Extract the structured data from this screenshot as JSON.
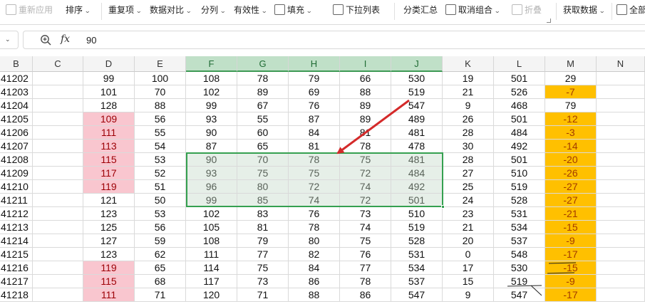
{
  "ribbon": {
    "reapply": "重新应用",
    "sort": "排序",
    "duplicates": "重复项",
    "compare": "数据对比",
    "split": "分列",
    "validity": "有效性",
    "fill": "填充",
    "dropdown": "下拉列表",
    "subtotal": "分类汇总",
    "ungroup": "取消组合",
    "collapse": "折叠",
    "get_data": "获取数据",
    "all": "全部"
  },
  "formula_bar": {
    "fx": "fx",
    "value": "90"
  },
  "columns": [
    "B",
    "C",
    "D",
    "E",
    "F",
    "G",
    "H",
    "I",
    "J",
    "K",
    "L",
    "M",
    "N"
  ],
  "selected_columns": [
    "F",
    "G",
    "H",
    "I",
    "J"
  ],
  "rows": [
    {
      "a": "41202",
      "d": "99",
      "e": "100",
      "f": "108",
      "g": "78",
      "h": "79",
      "i": "66",
      "j": "530",
      "k": "19",
      "l": "501",
      "m": "29"
    },
    {
      "a": "41203",
      "d": "101",
      "e": "70",
      "f": "102",
      "g": "89",
      "h": "69",
      "i": "88",
      "j": "519",
      "k": "21",
      "l": "526",
      "m": "-7"
    },
    {
      "a": "41204",
      "d": "128",
      "e": "88",
      "f": "99",
      "g": "67",
      "h": "76",
      "i": "89",
      "j": "547",
      "k": "9",
      "l": "468",
      "m": "79"
    },
    {
      "a": "41205",
      "d": "109",
      "e": "56",
      "f": "93",
      "g": "55",
      "h": "87",
      "i": "89",
      "j": "489",
      "k": "26",
      "l": "501",
      "m": "-12"
    },
    {
      "a": "41206",
      "d": "111",
      "e": "55",
      "f": "90",
      "g": "60",
      "h": "84",
      "i": "81",
      "j": "481",
      "k": "28",
      "l": "484",
      "m": "-3"
    },
    {
      "a": "41207",
      "d": "113",
      "e": "54",
      "f": "87",
      "g": "65",
      "h": "81",
      "i": "78",
      "j": "478",
      "k": "30",
      "l": "492",
      "m": "-14"
    },
    {
      "a": "41208",
      "d": "115",
      "e": "53",
      "f": "90",
      "g": "70",
      "h": "78",
      "i": "75",
      "j": "481",
      "k": "28",
      "l": "501",
      "m": "-20"
    },
    {
      "a": "41209",
      "d": "117",
      "e": "52",
      "f": "93",
      "g": "75",
      "h": "75",
      "i": "72",
      "j": "484",
      "k": "27",
      "l": "510",
      "m": "-26"
    },
    {
      "a": "41210",
      "d": "119",
      "e": "51",
      "f": "96",
      "g": "80",
      "h": "72",
      "i": "74",
      "j": "492",
      "k": "25",
      "l": "519",
      "m": "-27"
    },
    {
      "a": "41211",
      "d": "121",
      "e": "50",
      "f": "99",
      "g": "85",
      "h": "74",
      "i": "72",
      "j": "501",
      "k": "24",
      "l": "528",
      "m": "-27"
    },
    {
      "a": "41212",
      "d": "123",
      "e": "53",
      "f": "102",
      "g": "83",
      "h": "76",
      "i": "73",
      "j": "510",
      "k": "23",
      "l": "531",
      "m": "-21"
    },
    {
      "a": "41213",
      "d": "125",
      "e": "56",
      "f": "105",
      "g": "81",
      "h": "78",
      "i": "74",
      "j": "519",
      "k": "21",
      "l": "534",
      "m": "-15"
    },
    {
      "a": "41214",
      "d": "127",
      "e": "59",
      "f": "108",
      "g": "79",
      "h": "80",
      "i": "75",
      "j": "528",
      "k": "20",
      "l": "537",
      "m": "-9"
    },
    {
      "a": "41215",
      "d": "123",
      "e": "62",
      "f": "111",
      "g": "77",
      "h": "82",
      "i": "76",
      "j": "531",
      "k": "0",
      "l": "548",
      "m": "-17"
    },
    {
      "a": "41216",
      "d": "119",
      "e": "65",
      "f": "114",
      "g": "75",
      "h": "84",
      "i": "77",
      "j": "534",
      "k": "17",
      "l": "530",
      "m": "-15"
    },
    {
      "a": "41217",
      "d": "115",
      "e": "68",
      "f": "117",
      "g": "73",
      "h": "86",
      "i": "78",
      "j": "537",
      "k": "15",
      "l": "519",
      "m": "-9"
    },
    {
      "a": "41218",
      "d": "111",
      "e": "71",
      "f": "120",
      "g": "71",
      "h": "88",
      "i": "86",
      "j": "547",
      "k": "9",
      "l": "547",
      "m": "-17"
    }
  ],
  "colors": {
    "pink_fill": "#f9c6cf",
    "orange_fill": "#ffc000",
    "selection": "#35a050",
    "arrow": "#d42a2a"
  }
}
